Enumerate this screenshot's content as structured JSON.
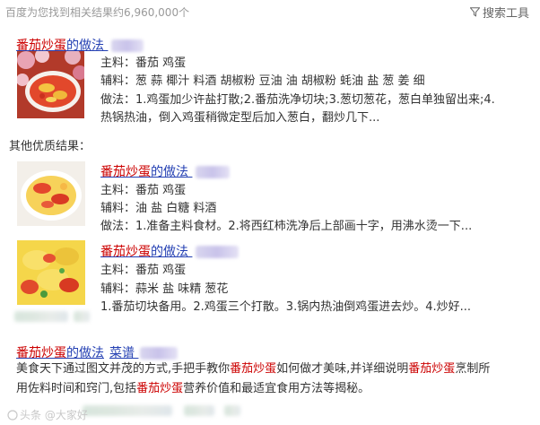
{
  "header": {
    "result_count": "百度为您找到相关结果约6,960,000个",
    "search_tools": "搜索工具"
  },
  "result1": {
    "title_red": "番茄炒蛋",
    "title_rest": "的做法",
    "main_ing": "主料：番茄 鸡蛋",
    "aux_ing": "辅料：葱 蒜 椰汁 料酒 胡椒粉 豆油 油 胡椒粉 蚝油 盐 葱 姜 细",
    "method_line1": "做法：1.鸡蛋加少许盐打散;2.番茄洗净切块;3.葱切葱花，葱白单独留出来;4.",
    "method_line2": "热锅热油，倒入鸡蛋稍微定型后加入葱白，翻炒几下..."
  },
  "other_label": "其他优质结果：",
  "result2": {
    "title_red": "番茄炒蛋",
    "title_rest": "的做法",
    "main_ing": "主料：番茄 鸡蛋",
    "aux_ing": "辅料：油 盐 白糖 料酒",
    "method": "做法：1.准备主料食材。2.将西红柿洗净后上部画十字，用沸水烫一下..."
  },
  "result3": {
    "title_red": "番茄炒蛋",
    "title_rest": "的做法",
    "main_ing": "主料：番茄 鸡蛋",
    "aux_ing": "辅料：蒜米 盐 味精 葱花",
    "method": "1.番茄切块备用。2.鸡蛋三个打散。3.锅内热油倒鸡蛋进去炒。4.炒好..."
  },
  "result4": {
    "title_red": "番茄炒蛋",
    "title_rest": "的做法",
    "title_extra": "菜谱",
    "desc_a": "美食天下通过图文并茂的方式,手把手教你",
    "desc_b": "番茄炒蛋",
    "desc_c": "如何做才美味,并详细说明",
    "desc_d": "番茄炒蛋",
    "desc_e": "烹制所",
    "desc_f": "用佐料时间和窍门,包括",
    "desc_g": "番茄炒蛋",
    "desc_h": "营养价值和最适宜食用方法等揭秘。"
  },
  "watermark": "头条 @大家好",
  "colors": {
    "link": "#2440b3",
    "highlight": "#cc0000",
    "muted": "#999999"
  },
  "icons": {
    "tools": "filter-funnel-icon"
  }
}
